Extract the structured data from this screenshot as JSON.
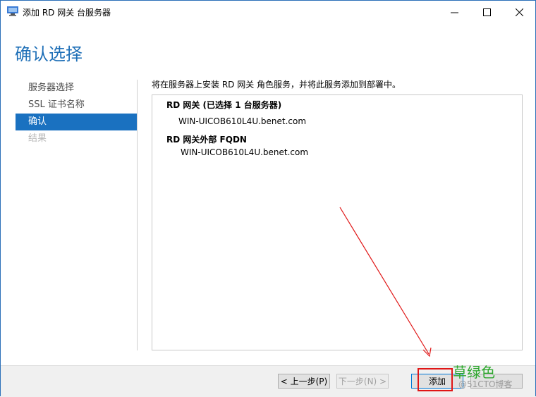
{
  "window": {
    "title": "添加 RD 网关 台服务器",
    "controls": {
      "minimize": "—",
      "maximize": "☐",
      "close": "✕"
    }
  },
  "header": {
    "title": "确认选择"
  },
  "nav": {
    "items": [
      {
        "label": "服务器选择",
        "state": "normal"
      },
      {
        "label": "SSL 证书名称",
        "state": "normal"
      },
      {
        "label": "确认",
        "state": "active"
      },
      {
        "label": "结果",
        "state": "disabled"
      }
    ]
  },
  "main": {
    "intro": "将在服务器上安装 RD 网关 角色服务，并将此服务添加到部署中。",
    "sections": [
      {
        "title": "RD 网关 (已选择 1 台服务器)",
        "value": "WIN-UICOB610L4U.benet.com"
      },
      {
        "title": "RD 网关外部 FQDN",
        "value": "WIN-UICOB610L4U.benet.com"
      }
    ]
  },
  "footer": {
    "prev_label": "< 上一步(P)",
    "next_label": "下一步(N) >",
    "add_label": "添加",
    "cancel_label": "取消"
  },
  "annotation": {
    "label": "草绿色",
    "color": "#2ea82e",
    "box_color": "#e01616"
  },
  "watermark": "@51CTO博客",
  "colors": {
    "accent": "#1e6fb7",
    "nav_active": "#1a71c0"
  }
}
